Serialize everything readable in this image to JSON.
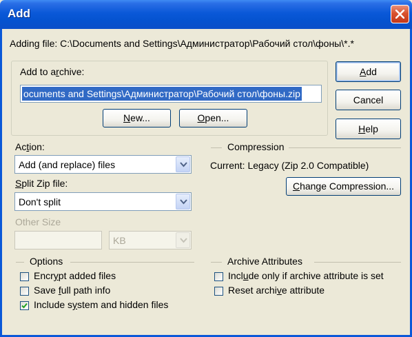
{
  "window": {
    "title": "Add",
    "close_label": "close"
  },
  "adding_file": "Adding file: C:\\Documents and Settings\\Администратор\\Рабочий стол\\фоны\\*.*",
  "archive": {
    "label": "Add to archive:",
    "path_value": "ocuments and Settings\\Администратор\\Рабочий стол\\фоны.zip",
    "new_button": "New...",
    "open_button": "Open..."
  },
  "buttons": {
    "add": "Add",
    "cancel": "Cancel",
    "help": "Help",
    "change_compression": "Change Compression..."
  },
  "action": {
    "label": "Action:",
    "selected": "Add (and replace) files"
  },
  "split": {
    "label": "Split Zip file:",
    "selected": "Don't split"
  },
  "other_size": {
    "label": "Other Size",
    "value": "",
    "unit": "KB"
  },
  "compression": {
    "header": "Compression",
    "current": "Current: Legacy (Zip 2.0 Compatible)"
  },
  "options": {
    "header": "Options",
    "items": [
      {
        "label": "Encrypt added files",
        "checked": false
      },
      {
        "label": "Save full path info",
        "checked": false
      },
      {
        "label": "Include system and hidden files",
        "checked": true
      }
    ]
  },
  "attributes": {
    "header": "Archive Attributes",
    "items": [
      {
        "label": "Include only if archive attribute is set",
        "checked": false
      },
      {
        "label": "Reset archive attribute",
        "checked": false
      }
    ]
  },
  "colors": {
    "titlebar": "#0a58d8",
    "dialog_bg": "#ece9d8",
    "selection": "#316ac5",
    "close_button": "#d9532f"
  }
}
